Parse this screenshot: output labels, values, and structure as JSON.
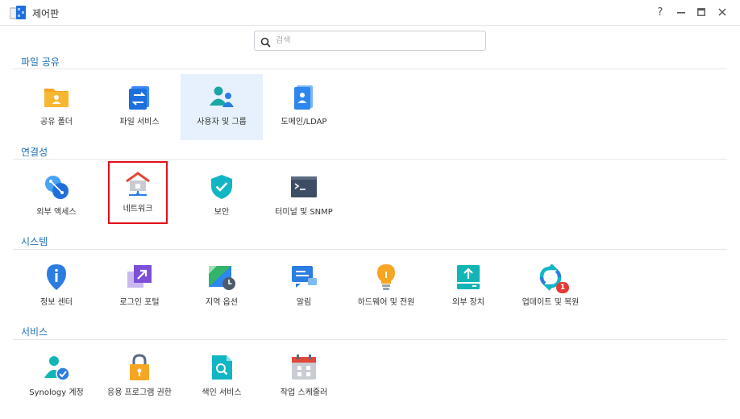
{
  "window": {
    "title": "제어판",
    "help_label": "?"
  },
  "search": {
    "placeholder": "검색"
  },
  "sections": {
    "file_sharing": {
      "title": "파일 공유",
      "items": [
        {
          "label": "공유 폴더",
          "icon": "shared-folder-icon"
        },
        {
          "label": "파일 서비스",
          "icon": "file-services-icon"
        },
        {
          "label": "사용자 및 그룹",
          "icon": "user-group-icon"
        },
        {
          "label": "도메인/LDAP",
          "icon": "domain-ldap-icon"
        }
      ]
    },
    "connectivity": {
      "title": "연결성",
      "items": [
        {
          "label": "외부 액세스",
          "icon": "external-access-icon"
        },
        {
          "label": "네트워크",
          "icon": "network-icon"
        },
        {
          "label": "보안",
          "icon": "security-shield-icon"
        },
        {
          "label": "터미널 및 SNMP",
          "icon": "terminal-icon"
        }
      ]
    },
    "system": {
      "title": "시스템",
      "items": [
        {
          "label": "정보 센터",
          "icon": "info-center-icon"
        },
        {
          "label": "로그인 포털",
          "icon": "login-portal-icon"
        },
        {
          "label": "지역 옵션",
          "icon": "regional-options-icon"
        },
        {
          "label": "알림",
          "icon": "notification-icon"
        },
        {
          "label": "하드웨어 및 전원",
          "icon": "hardware-power-icon"
        },
        {
          "label": "외부 장치",
          "icon": "external-devices-icon"
        },
        {
          "label": "업데이트 및 복원",
          "icon": "update-restore-icon",
          "badge": "1"
        }
      ]
    },
    "services": {
      "title": "서비스",
      "items": [
        {
          "label": "Synology 계정",
          "icon": "synology-account-icon"
        },
        {
          "label": "응용 프로그램 권한",
          "icon": "application-privileges-icon"
        },
        {
          "label": "색인 서비스",
          "icon": "indexing-service-icon"
        },
        {
          "label": "작업 스케줄러",
          "icon": "task-scheduler-icon"
        }
      ]
    }
  },
  "colors": {
    "section_title": "#1f6fb5",
    "selected_tile_bg": "#e6f1fd",
    "highlight_border": "#e0101a",
    "badge": "#e53935"
  }
}
